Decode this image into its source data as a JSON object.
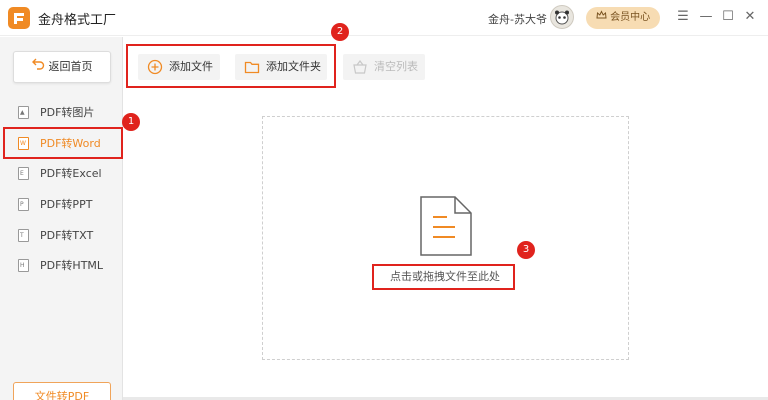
{
  "app": {
    "title": "金舟格式工厂"
  },
  "header": {
    "username": "金舟-苏大爷",
    "vip_label": "会员中心"
  },
  "window_controls": [
    "☰",
    "—",
    "☐",
    "✕"
  ],
  "sidebar": {
    "home_label": "返回首页",
    "items": [
      {
        "label": "PDF转图片",
        "icon": "image-file-icon"
      },
      {
        "label": "PDF转Word",
        "icon": "word-file-icon",
        "active": true
      },
      {
        "label": "PDF转Excel",
        "icon": "excel-file-icon"
      },
      {
        "label": "PDF转PPT",
        "icon": "ppt-file-icon"
      },
      {
        "label": "PDF转TXT",
        "icon": "txt-file-icon"
      },
      {
        "label": "PDF转HTML",
        "icon": "html-file-icon"
      }
    ],
    "bottom_label": "文件转PDF"
  },
  "toolbar": {
    "add_file_label": "添加文件",
    "add_folder_label": "添加文件夹",
    "clear_label": "清空列表"
  },
  "dropzone": {
    "hint": "点击或拖拽文件至此处"
  },
  "annotations": {
    "badge1": "1",
    "badge2": "2",
    "badge3": "3"
  },
  "colors": {
    "accent": "#f08a24",
    "annotation_red": "#e0231d",
    "vip_bg": "#f7dcb3"
  }
}
